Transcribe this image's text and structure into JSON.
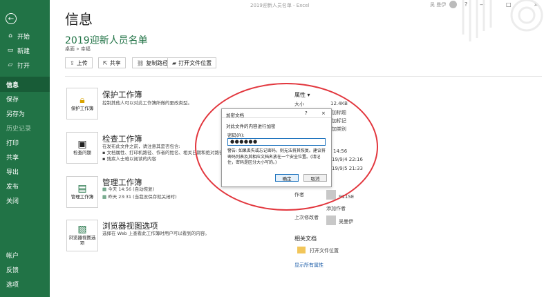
{
  "window": {
    "title": "2019迎新人员名单 - Excel",
    "user": "吴 曼伊",
    "controls": [
      "?",
      "—",
      "□",
      "×"
    ]
  },
  "sidebar": {
    "back_icon": "arrow-left-icon",
    "items": [
      {
        "label": "开始",
        "icon": "home-icon"
      },
      {
        "label": "新建",
        "icon": "new-icon"
      },
      {
        "label": "打开",
        "icon": "folder-open-icon"
      },
      {
        "label": "信息"
      },
      {
        "label": "保存"
      },
      {
        "label": "另存为"
      },
      {
        "label": "历史记录"
      },
      {
        "label": "打印"
      },
      {
        "label": "共享"
      },
      {
        "label": "导出"
      },
      {
        "label": "发布"
      },
      {
        "label": "关闭"
      }
    ],
    "bottom": [
      {
        "label": "帐户"
      },
      {
        "label": "反馈"
      },
      {
        "label": "选项"
      }
    ]
  },
  "main": {
    "page_title": "信息",
    "doc_title": "2019迎新人员名单",
    "breadcrumb": "桌面 » 幸福",
    "buttons": [
      {
        "label": "上传",
        "icon": "upload-icon"
      },
      {
        "label": "共享",
        "icon": "share-icon"
      },
      {
        "label": "复制路径",
        "icon": "link-icon"
      },
      {
        "label": "打开文件位置",
        "icon": "folder-icon"
      }
    ],
    "sections": [
      {
        "tile": "保护工作簿",
        "title": "保护工作簿",
        "lines": [
          "控制其他人可以对此工作簿所做的更改类型。"
        ]
      },
      {
        "tile": "检查问题",
        "title": "检查工作簿",
        "lines": [
          "在发布此文件之前，请注意其是否包含:",
          "▪ 文档属性、打印机路径、作者的姓名、相关日期和绝对路径",
          "▪ 残疾人士难以阅读的内容"
        ]
      },
      {
        "tile": "管理工作簿",
        "title": "管理工作簿",
        "lines": [
          "今天 14:56 (自动恢复)",
          "昨天 23:31 (当我没保存就关闭时)"
        ]
      },
      {
        "tile": "浏览器视图选项",
        "title": "浏览器视图选项",
        "lines": [
          "选择在 Web 上查看此工作簿时用户可以看到的内容。"
        ]
      }
    ]
  },
  "properties": {
    "header": "属性",
    "size_label": "大小",
    "size_value": "12.4KB",
    "value_frags": [
      "加标题",
      "加标记",
      "加类别"
    ],
    "dates": [
      "14:56",
      "19/9/4 22:16",
      "19/9/5 21:33"
    ],
    "author_label": "作者",
    "author": "911SE",
    "add_author": "添加作者",
    "last_modified_label": "上次修改者",
    "last_modified": "吴曼伊",
    "related_header": "相关文档",
    "open_location": "打开文件位置",
    "show_all": "显示所有属性"
  },
  "dialog": {
    "title": "加密文档",
    "help": "?",
    "close": "×",
    "caption": "对此文件的内容进行加密",
    "label": "密码(R):",
    "password_value": "●●●●●●",
    "warning": "警告: 如果丢失或忘记密码，则无法将其恢复。建议将密码列表及其相应文档名放在一个安全位置。(请记住，密码是区分大小写的。)",
    "ok": "确定",
    "cancel": "取消"
  },
  "colors": {
    "accent": "#217346",
    "annotation": "#e2363d"
  }
}
